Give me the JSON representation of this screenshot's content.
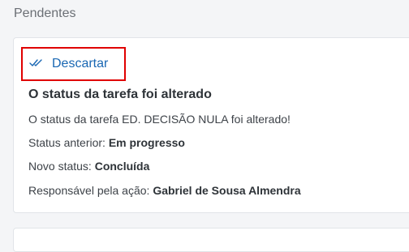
{
  "section": {
    "title": "Pendentes"
  },
  "notification": {
    "dismiss_label": "Descartar",
    "title": "O status da tarefa foi alterado",
    "message": "O status da tarefa ED. DECISÃO NULA foi alterado!",
    "previous_status_label": "Status anterior:",
    "previous_status_value": "Em progresso",
    "new_status_label": "Novo status:",
    "new_status_value": "Concluída",
    "responsible_label": "Responsável pela ação:",
    "responsible_value": "Gabriel de Sousa Almendra"
  },
  "colors": {
    "accent": "#1967b3",
    "highlight": "#e00000"
  }
}
